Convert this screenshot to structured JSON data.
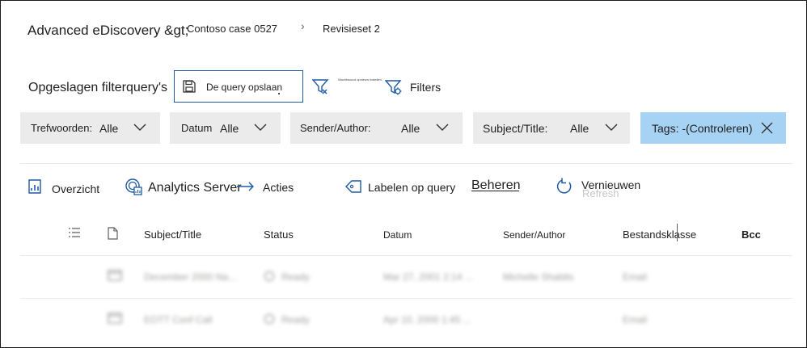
{
  "breadcrumb": {
    "root": "Advanced eDiscovery &gt;",
    "case": "Contoso case 0527",
    "separator": "›",
    "current": "Revisieset 2"
  },
  "toolbar": {
    "saved_queries_label": "Opgeslagen filterquery's",
    "save_query_label": "De query opslaan",
    "clear_keyword_label": "Wachtwoord opnieuw instellen",
    "filters_label": "Filters"
  },
  "filters": [
    {
      "key": "Trefwoorden:",
      "value": "Alle"
    },
    {
      "key": "Datum",
      "value": "Alle"
    },
    {
      "key": "Sender/Author:",
      "value": "Alle"
    },
    {
      "key": "Subject/Title:",
      "value": "Alle"
    }
  ],
  "tag_filter": {
    "value": "Tags: -(Controleren)"
  },
  "commands": {
    "overview": "Overzicht",
    "analytics": "Analytics Server",
    "actions": "Acties",
    "label_query": "Labelen op query",
    "manage": "Beheren",
    "refresh": "Vernieuwen",
    "refresh_ghost": "Refresh"
  },
  "table": {
    "columns": [
      "Subject/Title",
      "Status",
      "Datum",
      "Sender/Author",
      "Bestandsklasse",
      "Bcc"
    ],
    "rows": [
      {
        "subject": "December 2000 Na...",
        "status": "Ready",
        "date": "Mar 27, 2001 2:14 ...",
        "sender": "Michelle Shabits",
        "class": "Email"
      },
      {
        "subject": "EOTT Conf Call",
        "status": "Ready",
        "date": "Apr 10, 2000 1:45 ...",
        "sender": "",
        "class": "Email"
      }
    ]
  },
  "colors": {
    "accent": "#1f5aa6",
    "tag_bg": "#a6d2f4",
    "filter_bg": "#ebebeb"
  }
}
